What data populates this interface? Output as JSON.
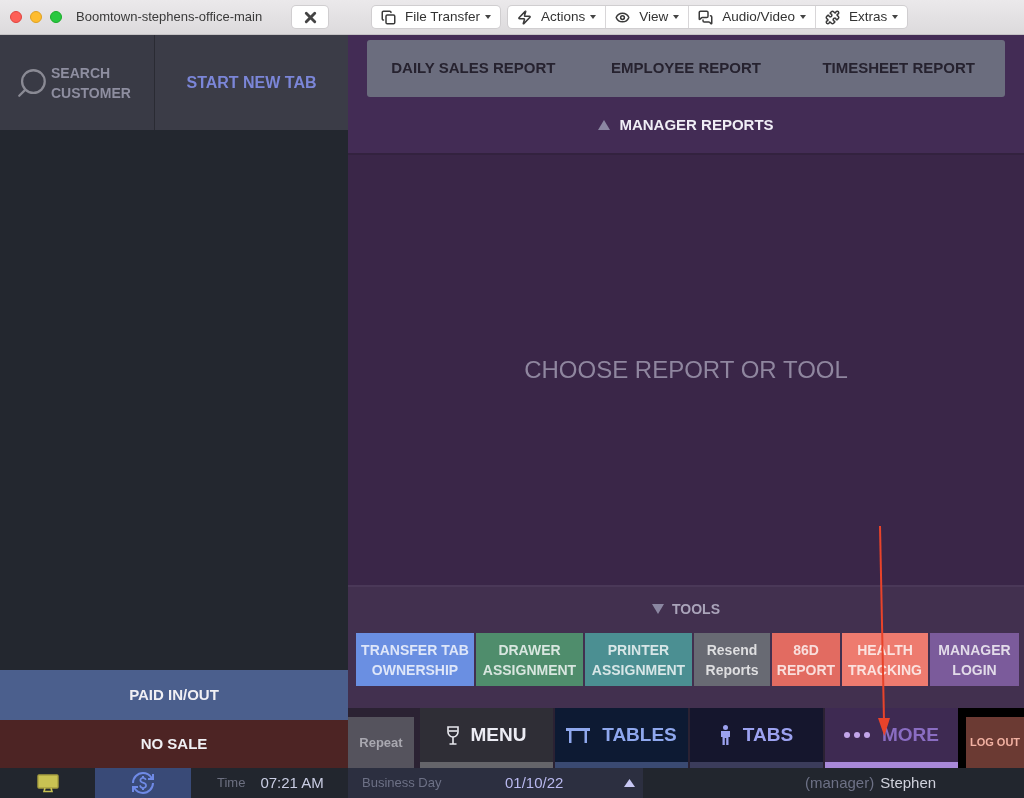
{
  "window": {
    "title": "Boomtown-stephens-office-main"
  },
  "remote_toolbar": [
    {
      "items": [
        {
          "label": "File Transfer",
          "kind": "file"
        }
      ]
    },
    {
      "items": [
        {
          "label": "Actions",
          "kind": "actions"
        },
        {
          "label": "View",
          "kind": "view"
        },
        {
          "label": "Audio/Video",
          "kind": "audio"
        },
        {
          "label": "Extras",
          "kind": "extras"
        }
      ]
    }
  ],
  "sidebar": {
    "search": {
      "label": "SEARCH\nCUSTOMER"
    },
    "new_tab": {
      "label": "START NEW TAB"
    },
    "actions": [
      {
        "label": "PAID IN/OUT",
        "kind": "paid"
      },
      {
        "label": "NO SALE",
        "kind": "nosale"
      }
    ]
  },
  "reports": {
    "items": [
      "DAILY SALES REPORT",
      "EMPLOYEE REPORT",
      "TIMESHEET REPORT"
    ],
    "title": "MANAGER REPORTS"
  },
  "main": {
    "message": "CHOOSE REPORT OR TOOL"
  },
  "tools": {
    "title": "TOOLS",
    "items": [
      {
        "label": "TRANSFER TAB\nOWNERSHIP",
        "color": "#6a8fe2"
      },
      {
        "label": "DRAWER\nASSIGNMENT",
        "color": "#4f8d6c"
      },
      {
        "label": "PRINTER\nASSIGNMENT",
        "color": "#4b8f92"
      },
      {
        "label": "Resend\nReports",
        "color": "#686a73"
      },
      {
        "label": "86D\nREPORT",
        "color": "#e26b61"
      },
      {
        "label": "HEALTH\nTRACKING",
        "color": "#ee7b6f"
      },
      {
        "label": "MANAGER\nLOGIN",
        "color": "#7b5b9b"
      }
    ]
  },
  "nav": {
    "repeat": "Repeat",
    "tabs": [
      {
        "label": "MENU",
        "kind": "menu",
        "selected": false
      },
      {
        "label": "TABLES",
        "kind": "tables",
        "selected": false
      },
      {
        "label": "TABS",
        "kind": "tabs",
        "selected": false
      },
      {
        "label": "MORE",
        "kind": "more",
        "selected": true
      }
    ],
    "logout": "LOG OUT"
  },
  "status_bar": {
    "time_label": "Time",
    "time": "07:21 AM",
    "business_day_label": "Business Day",
    "business_day": "01/10/22",
    "role": "(manager)",
    "user": "Stephen"
  }
}
